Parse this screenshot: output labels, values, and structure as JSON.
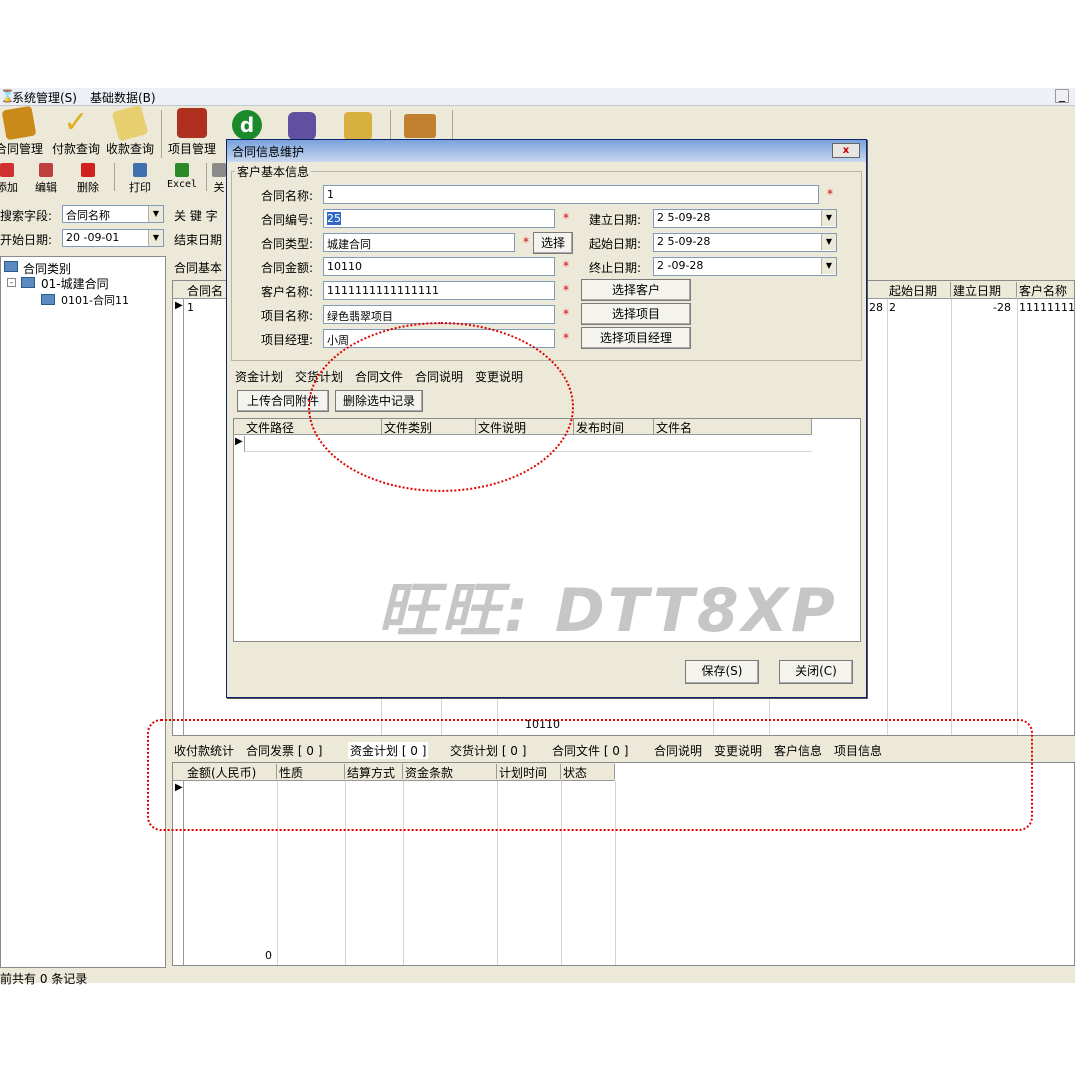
{
  "menu": {
    "system": "系统管理(S)",
    "basic": "基础数据(B)",
    "min": "_"
  },
  "toolbar_big": [
    {
      "label": "合同管理",
      "icon": "contract-icon",
      "color": "#c98a1a"
    },
    {
      "label": "付款查询",
      "icon": "check-icon",
      "color": "#e0b020"
    },
    {
      "label": "收款查询",
      "icon": "envelope-icon",
      "color": "#e8d070"
    },
    {
      "label": "项目管理",
      "icon": "project-icon",
      "color": "#b03020"
    }
  ],
  "toolbar_big_extra": [
    {
      "icon": "green-d-icon",
      "color": "#1a8a2a"
    },
    {
      "icon": "people-icon",
      "color": "#6050a0"
    },
    {
      "icon": "clock-icon",
      "color": "#d8b040"
    },
    {
      "icon": "printer-icon",
      "color": "#c08030"
    }
  ],
  "toolbar_small": [
    {
      "label": "添加",
      "icon": "add-icon",
      "color": "#d03030"
    },
    {
      "label": "编辑",
      "icon": "edit-icon",
      "color": "#c04040"
    },
    {
      "label": "删除",
      "icon": "delete-icon",
      "color": "#d02020"
    },
    {
      "label": "打印",
      "icon": "print-icon",
      "color": "#4070b0"
    },
    {
      "label": "Excel",
      "icon": "excel-icon",
      "color": "#2a8a2a"
    },
    {
      "label": "关",
      "icon": "exit-icon",
      "color": "#8a8a8a"
    }
  ],
  "search": {
    "field_label": "搜索字段:",
    "field_value": "合同名称",
    "keyword_label": "关 键 字",
    "start_label": "开始日期:",
    "start_value": "20  -09-01",
    "end_label": "结束日期"
  },
  "tree": {
    "root": "合同类别",
    "node1": "01-城建合同",
    "node2": "0101-合同11"
  },
  "main_grid": {
    "tab": "合同基本",
    "col_first": "合同名",
    "row_first": "1",
    "right_headers": [
      "起始日期",
      "建立日期",
      "客户名称"
    ],
    "right_values": [
      "28",
      "2",
      "-28",
      "11111111111"
    ],
    "total": "10110"
  },
  "bottom": {
    "tabs": [
      "收付款统计",
      "合同发票 [ 0 ]",
      "资金计划 [ 0 ]",
      "交货计划 [ 0 ]",
      "合同文件 [ 0 ]",
      "合同说明",
      "变更说明",
      "客户信息",
      "项目信息"
    ],
    "headers": [
      "金额(人民币)",
      "性质",
      "结算方式",
      "资金条款",
      "计划时间",
      "状态"
    ],
    "total": "0"
  },
  "status_bar": "前共有 0 条记录",
  "dialog": {
    "title": "合同信息维护",
    "close": "x",
    "group": "客户基本信息",
    "fields": {
      "name_label": "合同名称:",
      "name_value": "1",
      "code_label": "合同编号:",
      "code_value": "25",
      "type_label": "合同类型:",
      "type_value": "城建合同",
      "amount_label": "合同金额:",
      "amount_value": "10110",
      "customer_label": "客户名称:",
      "customer_value": "1111111111111111",
      "project_label": "项目名称:",
      "project_value": "绿色翡翠项目",
      "manager_label": "项目经理:",
      "manager_value": "小周",
      "created_label": "建立日期:",
      "created_value": "2  5-09-28",
      "start_label": "起始日期:",
      "start_value": "2  5-09-28",
      "end_label": "终止日期:",
      "end_value": "2    -09-28"
    },
    "buttons": {
      "select": "选择",
      "select_customer": "选择客户",
      "select_project": "选择项目",
      "select_manager": "选择项目经理",
      "upload": "上传合同附件",
      "delete_sel": "删除选中记录",
      "save": "保存(S)",
      "close": "关闭(C)"
    },
    "tabs": [
      "资金计划",
      "交货计划",
      "合同文件",
      "合同说明",
      "变更说明"
    ],
    "file_headers": [
      "文件路径",
      "文件类别",
      "文件说明",
      "发布时间",
      "文件名"
    ]
  },
  "watermark": "旺旺: DTT8XP",
  "highlight_color": "#e00000"
}
